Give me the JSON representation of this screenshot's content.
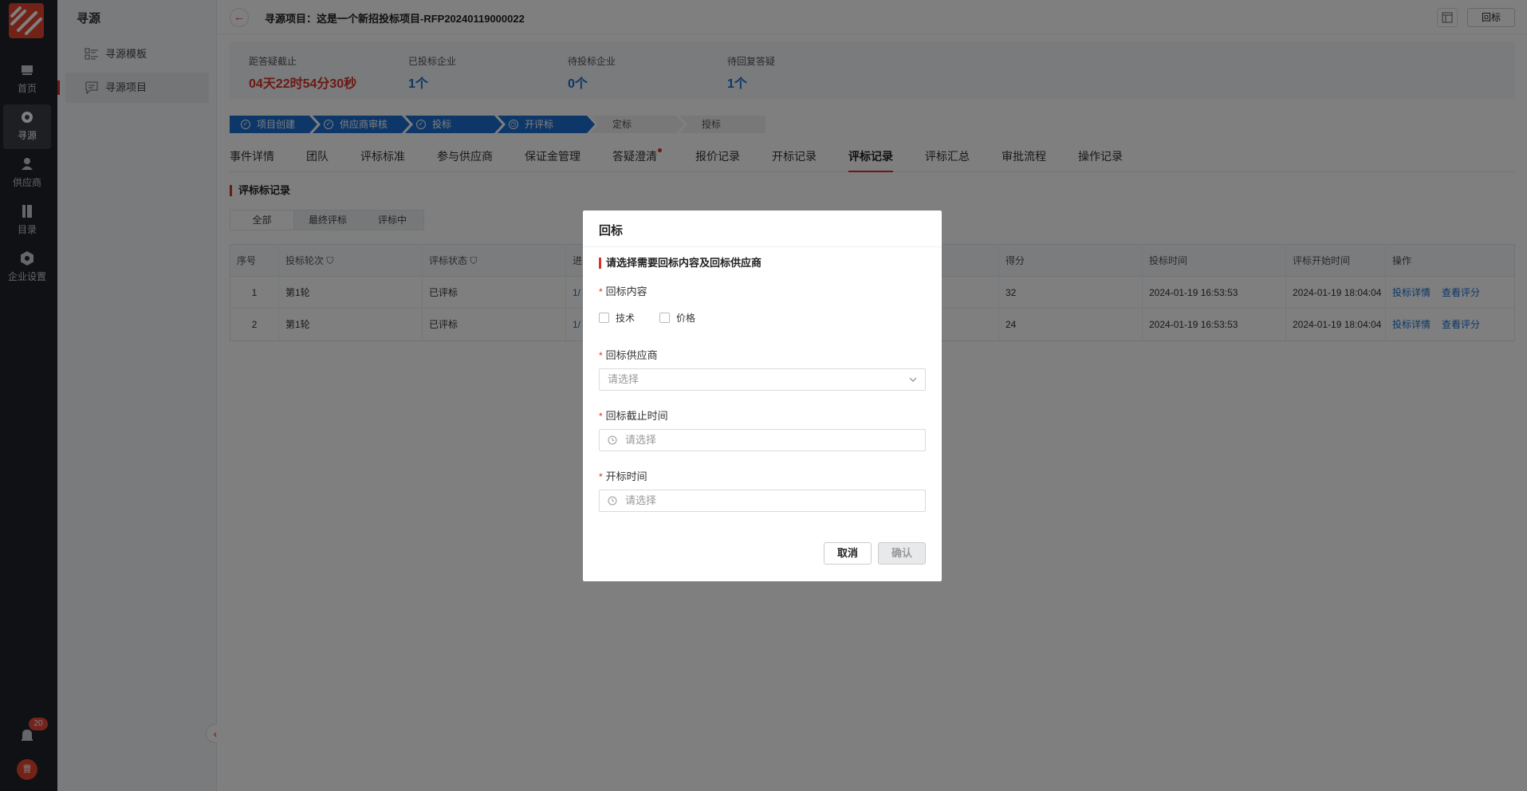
{
  "rail": {
    "items": [
      {
        "label": "首页",
        "icon": "home-icon"
      },
      {
        "label": "寻源",
        "icon": "sourcing-icon"
      },
      {
        "label": "供应商",
        "icon": "supplier-icon"
      },
      {
        "label": "目录",
        "icon": "catalog-icon"
      },
      {
        "label": "企业设置",
        "icon": "settings-icon"
      }
    ],
    "notification_count": "20",
    "avatar_text": "曹",
    "brand_color": "#e7442e"
  },
  "subside": {
    "title": "寻源",
    "items": [
      {
        "label": "寻源模板",
        "icon": "template-list-icon"
      },
      {
        "label": "寻源项目",
        "icon": "project-icon"
      }
    ]
  },
  "header": {
    "title": "寻源项目：这是一个新招投标项目-RFP20240119000022",
    "return_bid_label": "回标"
  },
  "stats": [
    {
      "label": "距答疑截止",
      "value": "04天22时54分30秒"
    },
    {
      "label": "已投标企业",
      "value": "1个"
    },
    {
      "label": "待投标企业",
      "value": "0个"
    },
    {
      "label": "待回复答疑",
      "value": "1个"
    }
  ],
  "steps": [
    {
      "label": "项目创建",
      "state": "done"
    },
    {
      "label": "供应商审核",
      "state": "done"
    },
    {
      "label": "投标",
      "state": "done"
    },
    {
      "label": "开评标",
      "state": "current"
    },
    {
      "label": "定标",
      "state": "pending"
    },
    {
      "label": "授标",
      "state": "pending"
    }
  ],
  "tabs": [
    "事件详情",
    "团队",
    "评标标准",
    "参与供应商",
    "保证金管理",
    "答疑澄清",
    "报价记录",
    "开标记录",
    "评标记录",
    "评标汇总",
    "审批流程",
    "操作记录"
  ],
  "section": {
    "title": "评标标记录",
    "segments": [
      "全部",
      "最终评标",
      "评标中"
    ]
  },
  "table": {
    "columns": [
      "序号",
      "投标轮次",
      "评标状态",
      "进",
      "得分",
      "投标时间",
      "评标开始时间",
      "操作"
    ],
    "rows": [
      {
        "no": "1",
        "round": "第1轮",
        "status": "已评标",
        "progress": "1/",
        "score": "32",
        "bid_time": "2024-01-19 16:53:53",
        "eval_start": "2024-01-19 18:04:04",
        "action1": "投标详情",
        "action2": "查看评分"
      },
      {
        "no": "2",
        "round": "第1轮",
        "status": "已评标",
        "progress": "1/",
        "score": "24",
        "bid_time": "2024-01-19 16:53:53",
        "eval_start": "2024-01-19 18:04:04",
        "action1": "投标详情",
        "action2": "查看评分"
      }
    ]
  },
  "modal": {
    "title": "回标",
    "subtitle": "请选择需要回标内容及回标供应商",
    "content_label": "回标内容",
    "options": [
      "技术",
      "价格"
    ],
    "supplier_label": "回标供应商",
    "supplier_placeholder": "请选择",
    "deadline_label": "回标截止时间",
    "deadline_placeholder": "请选择",
    "open_label": "开标时间",
    "open_placeholder": "请选择",
    "required_mark": "*",
    "cancel_label": "取消",
    "confirm_label": "确认"
  },
  "colors": {
    "accent": "#d6332a",
    "primary": "#1a6fd1",
    "rail_bg": "#1f2329"
  }
}
